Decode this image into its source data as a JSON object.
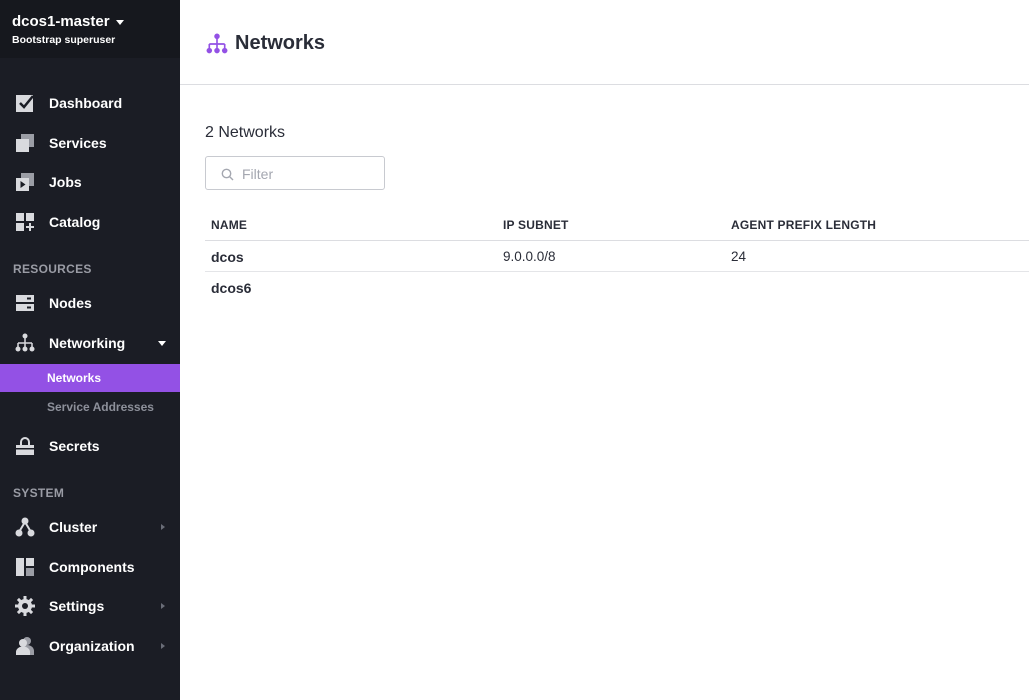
{
  "sidebar": {
    "cluster_name": "dcos1-master",
    "user_role": "Bootstrap superuser",
    "items": [
      {
        "label": "Dashboard"
      },
      {
        "label": "Services"
      },
      {
        "label": "Jobs"
      },
      {
        "label": "Catalog"
      }
    ],
    "resources_heading": "RESOURCES",
    "resources": [
      {
        "label": "Nodes"
      },
      {
        "label": "Networking"
      }
    ],
    "networking_sub": [
      {
        "label": "Networks",
        "active": true
      },
      {
        "label": "Service Addresses",
        "active": false
      }
    ],
    "secrets": {
      "label": "Secrets"
    },
    "system_heading": "SYSTEM",
    "system": [
      {
        "label": "Cluster"
      },
      {
        "label": "Components"
      },
      {
        "label": "Settings"
      },
      {
        "label": "Organization"
      }
    ]
  },
  "colors": {
    "sidebar_bg": "#1b1d25",
    "accent": "#9351e5"
  },
  "main": {
    "page_title": "Networks",
    "count_title": "2 Networks",
    "filter": {
      "placeholder": "Filter",
      "value": ""
    },
    "table": {
      "columns": [
        "NAME",
        "IP SUBNET",
        "AGENT PREFIX LENGTH"
      ],
      "rows": [
        {
          "name": "dcos",
          "subnet": "9.0.0.0/8",
          "prefix": "24"
        },
        {
          "name": "dcos6",
          "subnet": "",
          "prefix": ""
        }
      ]
    }
  }
}
